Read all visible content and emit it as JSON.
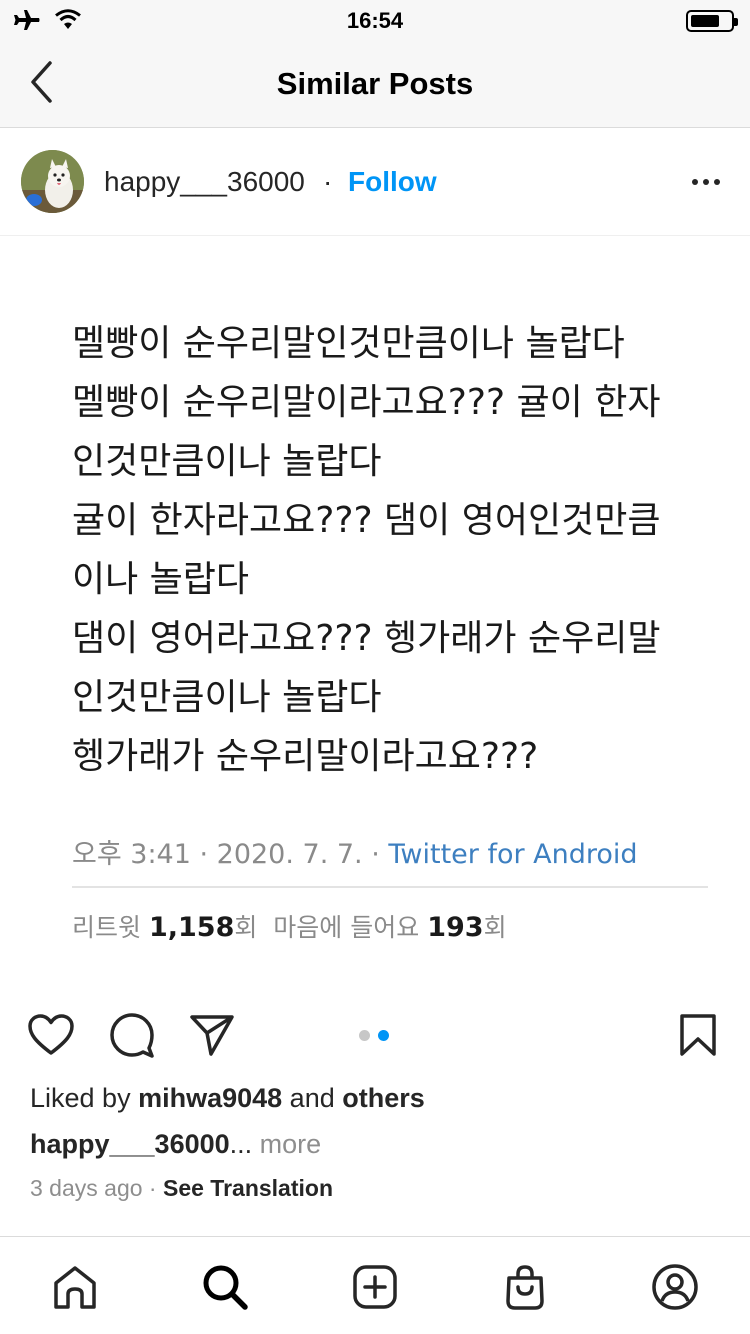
{
  "status_bar": {
    "time": "16:54",
    "icons": [
      "airplane-icon",
      "wifi-icon",
      "battery-icon"
    ]
  },
  "header": {
    "title": "Similar Posts",
    "back_icon": "chevron-left-icon"
  },
  "post": {
    "username": "happy___36000",
    "separator": "·",
    "follow_label": "Follow",
    "more_icon": "more-horizontal-icon",
    "image": {
      "tweet_lines": [
        "멜빵이 순우리말인것만큼이나 놀랍다",
        "멜빵이 순우리말이라고요??? 귤이 한자",
        "인것만큼이나 놀랍다",
        "귤이 한자라고요??? 댐이 영어인것만큼",
        "이나 놀랍다",
        "댐이 영어라고요??? 헹가래가 순우리말",
        "인것만큼이나 놀랍다",
        "헹가래가 순우리말이라고요???"
      ],
      "meta_time": "오후 3:41 · 2020. 7. 7. · ",
      "meta_source": "Twitter for Android",
      "retweet_label": "리트윗 ",
      "retweet_count": "1,158",
      "count_suffix": "회",
      "likes_label": "마음에 들어요 ",
      "likes_count": "193"
    },
    "actions": {
      "like_icon": "heart-icon",
      "comment_icon": "comment-icon",
      "share_icon": "send-icon",
      "save_icon": "bookmark-icon",
      "carousel_total": 2,
      "carousel_active": 2
    },
    "liked_by_prefix": "Liked by ",
    "liked_by_user": "mihwa9048",
    "liked_by_and": " and ",
    "liked_by_others": "others",
    "caption_user": "happy___36000",
    "caption_ellipsis": "...",
    "caption_more": " more",
    "time_ago": "3 days ago",
    "time_separator": " · ",
    "see_translation": "See Translation"
  },
  "tab_bar": {
    "items": [
      "home-icon",
      "search-icon",
      "new-post-icon",
      "shop-icon",
      "profile-icon"
    ]
  },
  "colors": {
    "accent": "#0095f6",
    "text": "#262626",
    "muted": "#8e8e8e",
    "twitter_source": "#3d7fc0",
    "dot_active": "#0095f6",
    "dot_inactive": "#c7c7c7"
  }
}
